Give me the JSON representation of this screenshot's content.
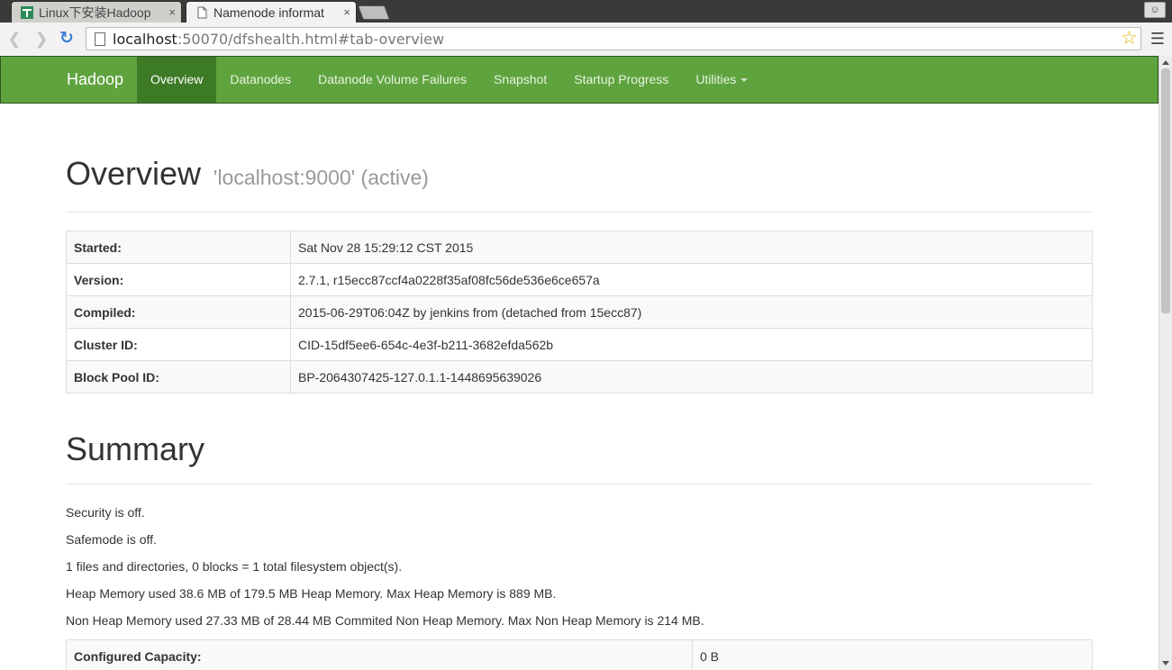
{
  "browser": {
    "tabs": [
      {
        "title": "Linux下安装Hadoop",
        "active": false,
        "icon": "site-favicon"
      },
      {
        "title": "Namenode informat",
        "active": true,
        "icon": "page-icon"
      }
    ],
    "close_glyph": "×",
    "url": {
      "host": "localhost",
      "rest": ":50070/dfshealth.html#tab-overview"
    }
  },
  "navbar": {
    "brand": "Hadoop",
    "items": [
      {
        "label": "Overview",
        "active": true
      },
      {
        "label": "Datanodes",
        "active": false
      },
      {
        "label": "Datanode Volume Failures",
        "active": false
      },
      {
        "label": "Snapshot",
        "active": false
      },
      {
        "label": "Startup Progress",
        "active": false
      },
      {
        "label": "Utilities",
        "active": false,
        "dropdown": true
      }
    ],
    "color": "#5fa33e",
    "active_color": "#3d7a26"
  },
  "overview": {
    "title": "Overview",
    "subtitle": "'localhost:9000' (active)",
    "rows": [
      {
        "key": "Started:",
        "value": "Sat Nov 28 15:29:12 CST 2015"
      },
      {
        "key": "Version:",
        "value": "2.7.1, r15ecc87ccf4a0228f35af08fc56de536e6ce657a"
      },
      {
        "key": "Compiled:",
        "value": "2015-06-29T06:04Z by jenkins from (detached from 15ecc87)"
      },
      {
        "key": "Cluster ID:",
        "value": "CID-15df5ee6-654c-4e3f-b211-3682efda562b"
      },
      {
        "key": "Block Pool ID:",
        "value": "BP-2064307425-127.0.1.1-1448695639026"
      }
    ]
  },
  "summary": {
    "title": "Summary",
    "lines": [
      "Security is off.",
      "Safemode is off.",
      "1 files and directories, 0 blocks = 1 total filesystem object(s).",
      "Heap Memory used 38.6 MB of 179.5 MB Heap Memory. Max Heap Memory is 889 MB.",
      "Non Heap Memory used 27.33 MB of 28.44 MB Commited Non Heap Memory. Max Non Heap Memory is 214 MB."
    ],
    "capacity": {
      "key": "Configured Capacity:",
      "value": "0 B"
    }
  }
}
